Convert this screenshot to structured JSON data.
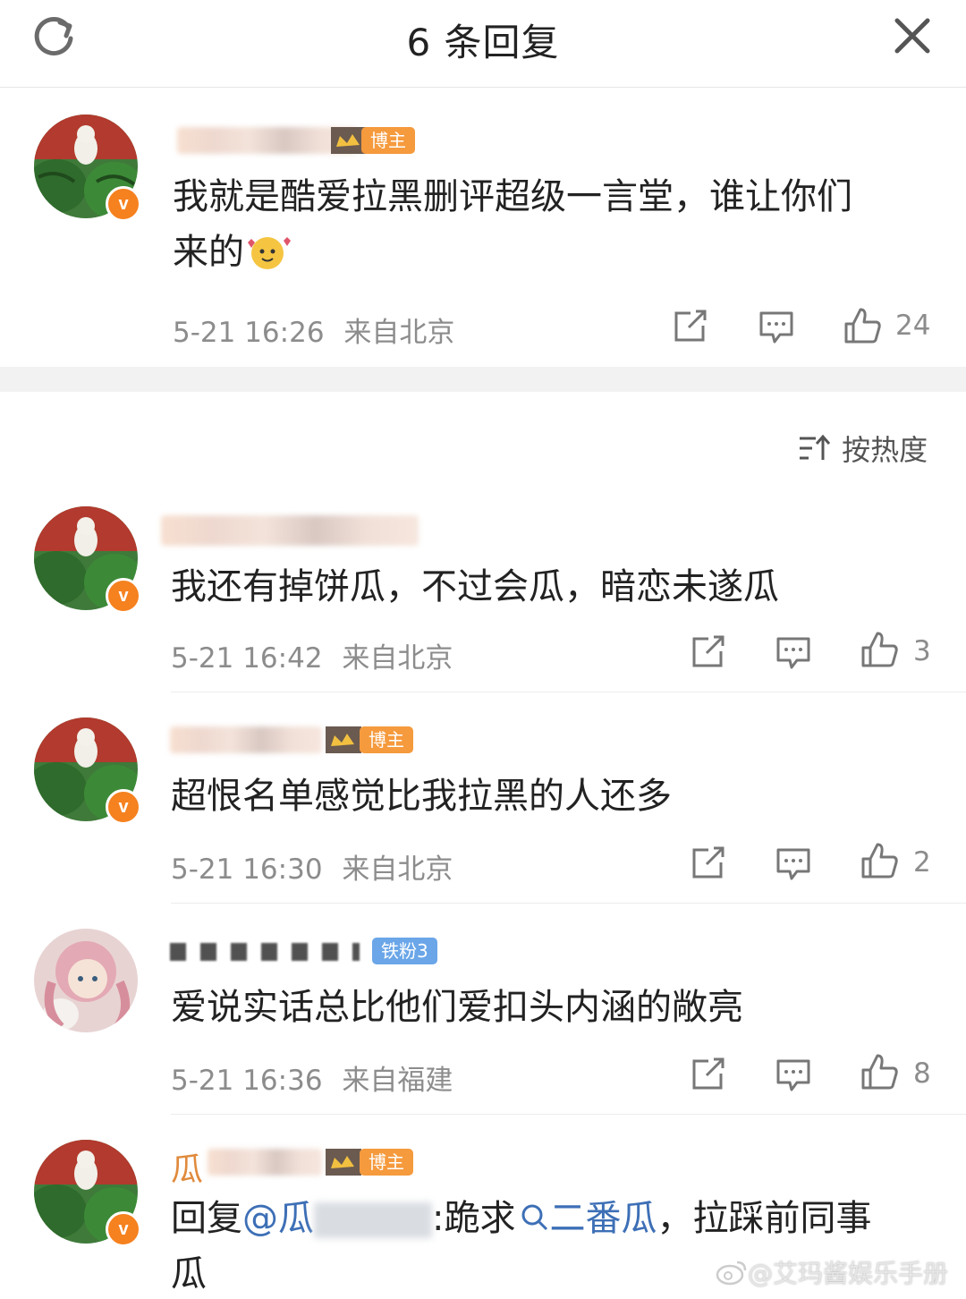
{
  "header": {
    "title": "6 条回复",
    "refresh_icon": "refresh-icon",
    "close_icon": "close-icon"
  },
  "main_comment": {
    "author_badge": "博主",
    "text_line1": "我就是酷爱拉黑删评超级一言堂，谁让你们",
    "text_line2": "来的",
    "timestamp": "5-21 16:26",
    "location": "来自北京",
    "likes": "24"
  },
  "sort": {
    "label": "按热度",
    "icon": "sort-icon"
  },
  "replies": [
    {
      "badge": "",
      "text": "我还有掉饼瓜，不过会瓜，暗恋未遂瓜",
      "timestamp": "5-21 16:42",
      "location": "来自北京",
      "likes": "3"
    },
    {
      "badge": "博主",
      "text": "超恨名单感觉比我拉黑的人还多",
      "timestamp": "5-21 16:30",
      "location": "来自北京",
      "likes": "2"
    },
    {
      "badge": "铁粉3",
      "text": "爱说实话总比他们爱扣头内涵的敞亮",
      "timestamp": "5-21 16:36",
      "location": "来自福建",
      "likes": "8"
    },
    {
      "badge": "博主",
      "name_visible": "瓜",
      "text_prefix": "回复",
      "mention": "@瓜",
      "text_rest": ":跪求",
      "search_link": "二番瓜",
      "text_tail": "，拉踩前同事",
      "text_line2": "瓜"
    }
  ],
  "watermark": "@艾玛酱娱乐手册",
  "colors": {
    "accent_orange": "#f5811f",
    "badge_orange": "#f59a3d",
    "badge_blue": "#6aa6e8",
    "link_blue": "#3d6fb6",
    "meta_gray": "#8c8c8c"
  }
}
